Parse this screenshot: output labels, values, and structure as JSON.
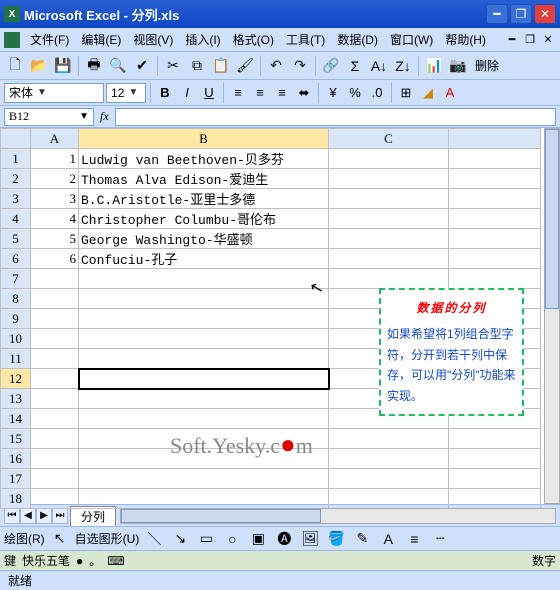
{
  "window": {
    "title": "Microsoft Excel - 分列.xls"
  },
  "menus": {
    "file": "文件(F)",
    "edit": "编辑(E)",
    "view": "视图(V)",
    "insert": "插入(I)",
    "format": "格式(O)",
    "tools": "工具(T)",
    "data": "数据(D)",
    "window": "窗口(W)",
    "help": "帮助(H)"
  },
  "format": {
    "font_name": "宋体",
    "font_size": "12"
  },
  "namebox": {
    "ref": "B12"
  },
  "columns": {
    "A": "A",
    "B": "B",
    "C": "C"
  },
  "rows": [
    {
      "n": "1",
      "a": "1",
      "b": "Ludwig van Beethoven-贝多芬"
    },
    {
      "n": "2",
      "a": "2",
      "b": "Thomas Alva Edison-爱迪生"
    },
    {
      "n": "3",
      "a": "3",
      "b": "B.C.Aristotle-亚里士多德"
    },
    {
      "n": "4",
      "a": "4",
      "b": "Christopher Columbu-哥伦布"
    },
    {
      "n": "5",
      "a": "5",
      "b": "George Washingto-华盛顿"
    },
    {
      "n": "6",
      "a": "6",
      "b": "Confuciu-孔子"
    },
    {
      "n": "7",
      "a": "",
      "b": ""
    },
    {
      "n": "8",
      "a": "",
      "b": ""
    },
    {
      "n": "9",
      "a": "",
      "b": ""
    },
    {
      "n": "10",
      "a": "",
      "b": ""
    },
    {
      "n": "11",
      "a": "",
      "b": ""
    },
    {
      "n": "12",
      "a": "",
      "b": ""
    },
    {
      "n": "13",
      "a": "",
      "b": ""
    },
    {
      "n": "14",
      "a": "",
      "b": ""
    },
    {
      "n": "15",
      "a": "",
      "b": ""
    },
    {
      "n": "16",
      "a": "",
      "b": ""
    },
    {
      "n": "17",
      "a": "",
      "b": ""
    },
    {
      "n": "18",
      "a": "",
      "b": ""
    }
  ],
  "callout": {
    "title": "数据的分列",
    "body": "如果希望将1列组合型字符，分开到若干列中保存，可以用\"分列\"功能来实现。"
  },
  "watermark": {
    "left": "Soft.Yesky.c",
    "right": "m"
  },
  "sheet": {
    "tab": "分列"
  },
  "drawbar": {
    "draw": "绘图(R)",
    "autoshape": "自选图形(U)"
  },
  "ime": {
    "name": "快乐五笔"
  },
  "status": {
    "ready": "就绪",
    "num": "数字"
  },
  "toolbar_end": "删除"
}
